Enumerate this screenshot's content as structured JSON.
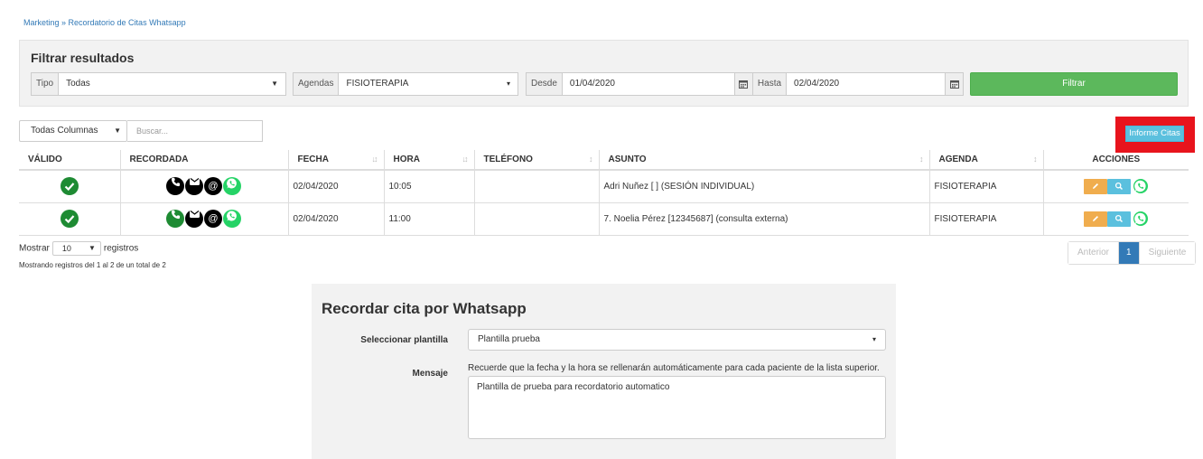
{
  "breadcrumb": "Marketing » Recordatorio de Citas Whatsapp",
  "filter": {
    "title": "Filtrar resultados",
    "tipo_label": "Tipo",
    "tipo_value": "Todas",
    "agendas_label": "Agendas",
    "agendas_value": "FISIOTERAPIA",
    "desde_label": "Desde",
    "desde_value": "01/04/2020",
    "hasta_label": "Hasta",
    "hasta_value": "02/04/2020",
    "button": "Filtrar"
  },
  "toolbar": {
    "columns_select": "Todas Columnas",
    "search_placeholder": "Buscar...",
    "informe_button": "Informe Citas"
  },
  "table": {
    "headers": [
      "VÁLIDO",
      "RECORDADA",
      "FECHA",
      "HORA",
      "TELÉFONO",
      "ASUNTO",
      "AGENDA",
      "ACCIONES"
    ],
    "rows": [
      {
        "fecha": "02/04/2020",
        "hora": "10:05",
        "telefono": "",
        "asunto": "Adri Nuñez [               ] (SESIÓN INDIVIDUAL)",
        "agenda": "FISIOTERAPIA",
        "phone_color": "#000000"
      },
      {
        "fecha": "02/04/2020",
        "hora": "11:00",
        "telefono": "",
        "asunto": "7. Noelia Pérez [12345687] (consulta externa)",
        "agenda": "FISIOTERAPIA",
        "phone_color": "#1e8b33"
      }
    ]
  },
  "pagination": {
    "mostrar": "Mostrar",
    "length": "10",
    "registros": "registros",
    "info": "Mostrando registros del 1 al 2 de un total de 2",
    "prev": "Anterior",
    "page": "1",
    "next": "Siguiente"
  },
  "whatsapp": {
    "title": "Recordar cita por Whatsapp",
    "template_label": "Seleccionar plantilla",
    "template_value": "Plantilla prueba",
    "message_label": "Mensaje",
    "hint": "Recuerde que la fecha y la hora se rellenarán automáticamente para cada paciente de la lista superior.",
    "message": "Plantilla de prueba para recordatorio automatico"
  },
  "colors": {
    "accent_green": "#5cb85c",
    "info_blue": "#5bc0de",
    "highlight_red": "#e8141d",
    "primary": "#337ab7"
  }
}
